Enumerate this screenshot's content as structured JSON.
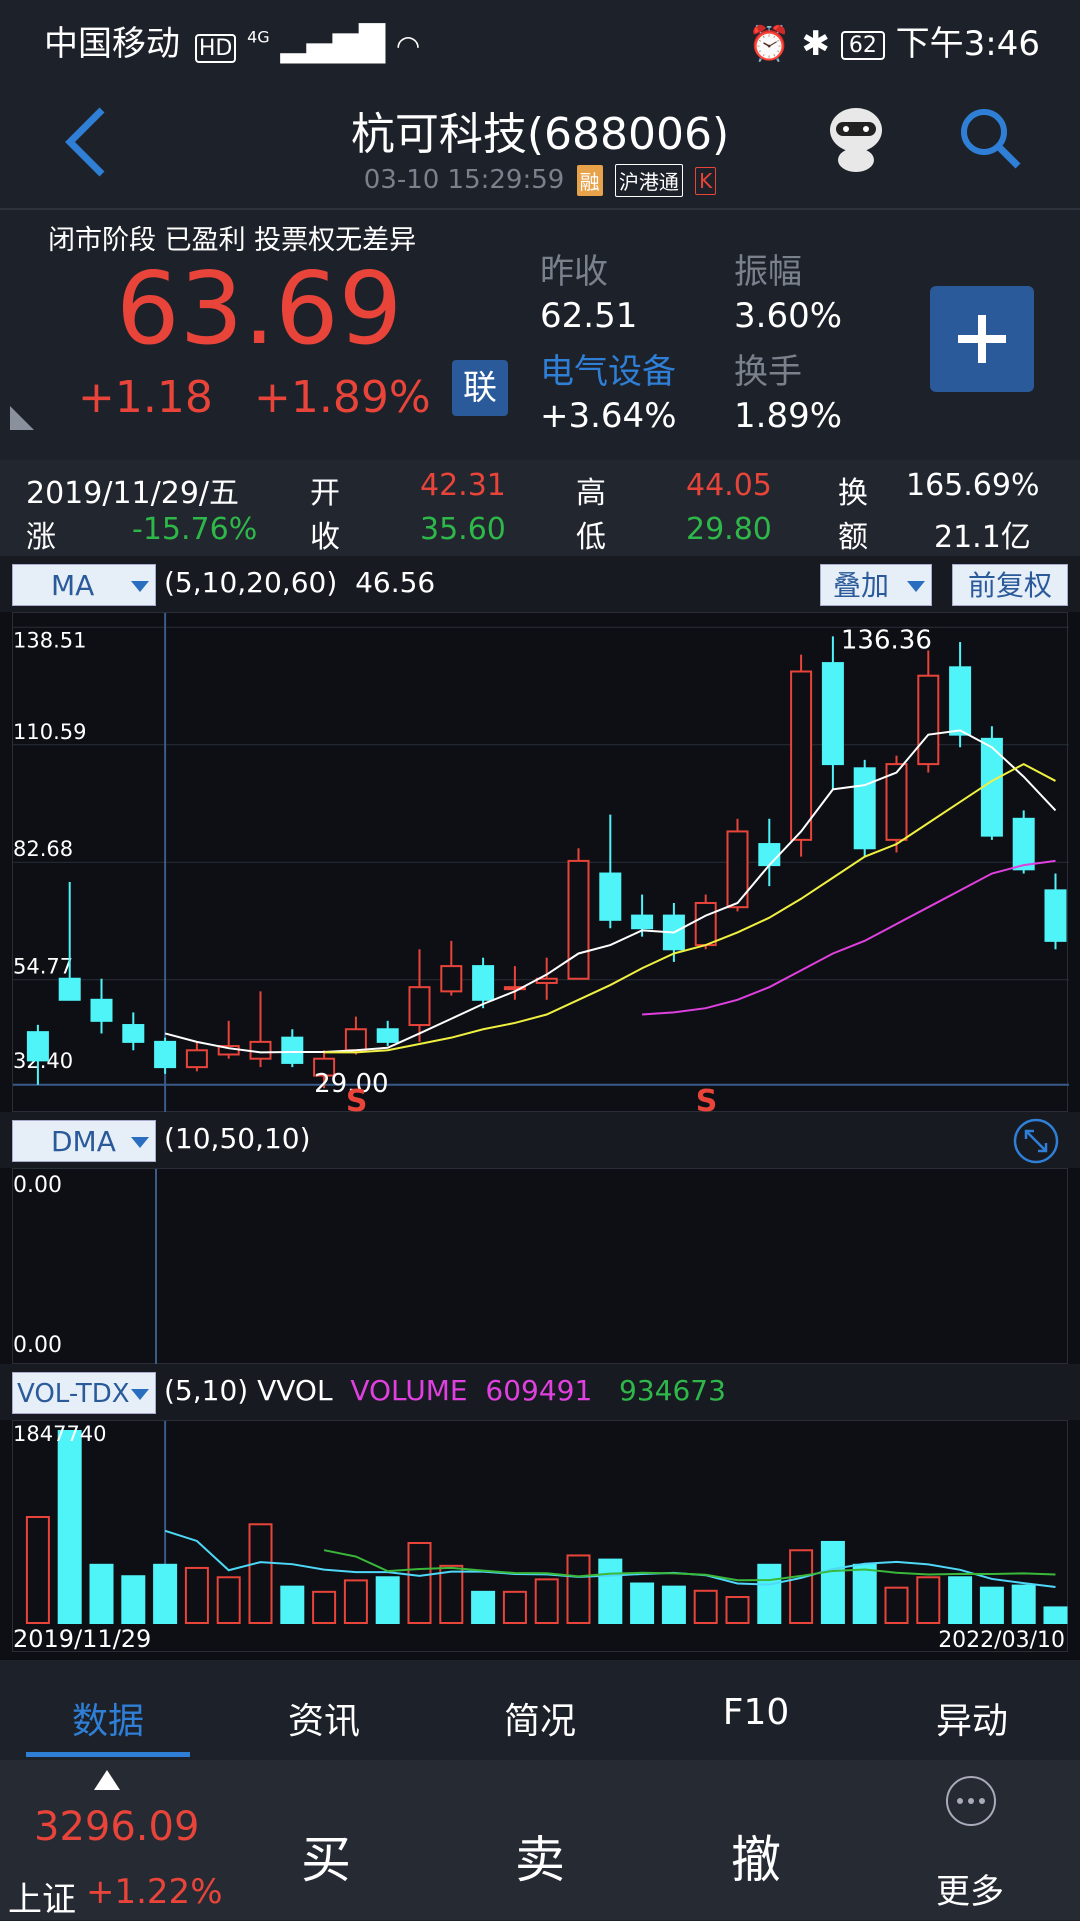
{
  "status": {
    "carrier": "中国移动",
    "hd": "HD",
    "net": "4G",
    "battery": "62",
    "time": "下午3:46"
  },
  "header": {
    "title": "杭可科技(688006)",
    "datetime": "03-10 15:29:59",
    "tag_rong": "融",
    "tag_hgt": "沪港通",
    "tag_k": "K"
  },
  "quote": {
    "phase": "闭市阶段  已盈利  投票权无差异",
    "price": "63.69",
    "change": "+1.18",
    "change_pct": "+1.89%",
    "lian": "联",
    "prev_close_label": "昨收",
    "prev_close": "62.51",
    "amplitude_label": "振幅",
    "amplitude": "3.60%",
    "sector": "电气设备",
    "sector_change": "+3.64%",
    "turnover_label": "换手",
    "turnover": "1.89%"
  },
  "detail": {
    "date": "2019/11/29/五",
    "open_label": "开",
    "open": "42.31",
    "high_label": "高",
    "high": "44.05",
    "turn_label": "换",
    "turn": "165.69%",
    "chg_label": "涨",
    "chg": "-15.76%",
    "close_label": "收",
    "close": "35.60",
    "low_label": "低",
    "low": "29.80",
    "amount_label": "额",
    "amount": "21.1亿"
  },
  "ma": {
    "name": "MA",
    "params": "(5,10,20,60)",
    "value": "46.56",
    "overlay": "叠加",
    "adjust": "前复权"
  },
  "price_axis": {
    "labels": [
      "138.51",
      "110.59",
      "82.68",
      "54.77",
      "32.40"
    ],
    "low_mark": "29.00",
    "high_mark": "136.36",
    "s_mark": "S"
  },
  "dma": {
    "name": "DMA",
    "params": "(10,50,10)",
    "top": "0.00",
    "bottom": "0.00"
  },
  "vol": {
    "name": "VOL-TDX",
    "params": "(5,10) VVOL",
    "volume_label": "VOLUME",
    "v1": "609491",
    "v2": "934673",
    "max": "1847740",
    "start_date": "2019/11/29",
    "end_date": "2022/03/10"
  },
  "tabs": [
    "数据",
    "资讯",
    "简况",
    "F10",
    "异动"
  ],
  "index": {
    "value": "3296.09",
    "name": "上证",
    "pct": "+1.22%"
  },
  "actions": {
    "buy": "买",
    "sell": "卖",
    "cancel": "撤",
    "more": "更多"
  },
  "chart_data": {
    "type": "candlestick",
    "candles": [
      {
        "o": 42.31,
        "c": 35.6,
        "h": 44.05,
        "l": 29.8
      },
      {
        "o": 55,
        "c": 50,
        "h": 78,
        "l": 52
      },
      {
        "o": 50,
        "c": 45,
        "h": 55,
        "l": 42
      },
      {
        "o": 44,
        "c": 40,
        "h": 47,
        "l": 38
      },
      {
        "o": 40,
        "c": 34,
        "h": 41,
        "l": 32.4
      },
      {
        "o": 34,
        "c": 38,
        "h": 40,
        "l": 33
      },
      {
        "o": 37,
        "c": 39,
        "h": 45,
        "l": 36
      },
      {
        "o": 36,
        "c": 40,
        "h": 52,
        "l": 34
      },
      {
        "o": 41,
        "c": 35,
        "h": 43,
        "l": 34
      },
      {
        "o": 32,
        "c": 36,
        "h": 38,
        "l": 29
      },
      {
        "o": 38,
        "c": 43,
        "h": 46,
        "l": 37
      },
      {
        "o": 43,
        "c": 40,
        "h": 45,
        "l": 39
      },
      {
        "o": 44,
        "c": 53,
        "h": 62,
        "l": 40
      },
      {
        "o": 52,
        "c": 58,
        "h": 64,
        "l": 51
      },
      {
        "o": 58,
        "c": 50,
        "h": 60,
        "l": 48
      },
      {
        "o": 53,
        "c": 53,
        "h": 58,
        "l": 50
      },
      {
        "o": 54,
        "c": 55,
        "h": 60,
        "l": 50
      },
      {
        "o": 55,
        "c": 83,
        "h": 86,
        "l": 55
      },
      {
        "o": 80,
        "c": 69,
        "h": 94,
        "l": 67
      },
      {
        "o": 70,
        "c": 67,
        "h": 75,
        "l": 65
      },
      {
        "o": 70,
        "c": 62,
        "h": 73,
        "l": 59
      },
      {
        "o": 63,
        "c": 73,
        "h": 75,
        "l": 62
      },
      {
        "o": 72,
        "c": 90,
        "h": 93,
        "l": 71
      },
      {
        "o": 87,
        "c": 82,
        "h": 93,
        "l": 77
      },
      {
        "o": 88,
        "c": 128,
        "h": 132,
        "l": 84
      },
      {
        "o": 130,
        "c": 106,
        "h": 136.36,
        "l": 100
      },
      {
        "o": 105,
        "c": 86,
        "h": 107,
        "l": 84
      },
      {
        "o": 88,
        "c": 106,
        "h": 108,
        "l": 85
      },
      {
        "o": 106,
        "c": 127,
        "h": 133,
        "l": 104
      },
      {
        "o": 129,
        "c": 113,
        "h": 135,
        "l": 110
      },
      {
        "o": 112,
        "c": 89,
        "h": 115,
        "l": 88
      },
      {
        "o": 93,
        "c": 81,
        "h": 95,
        "l": 80
      },
      {
        "o": 76,
        "c": 64,
        "h": 80,
        "l": 62
      }
    ],
    "ma5": [
      null,
      null,
      null,
      null,
      42,
      40,
      38.5,
      37.5,
      37.6,
      37.6,
      38,
      38.6,
      42,
      45.5,
      49,
      52,
      56,
      61,
      63,
      66.5,
      66,
      70,
      73,
      82,
      90,
      100,
      101,
      104,
      113,
      114,
      110,
      103,
      95
    ],
    "ma10": [
      null,
      null,
      null,
      null,
      null,
      null,
      null,
      null,
      null,
      37.5,
      37.5,
      38,
      39.5,
      41,
      43,
      44.5,
      46.5,
      50,
      53.5,
      57.5,
      61,
      63,
      66,
      69.5,
      74,
      79,
      84,
      87,
      92,
      97,
      102,
      106,
      102
    ],
    "ma20": [
      null,
      null,
      null,
      null,
      null,
      null,
      null,
      null,
      null,
      null,
      null,
      null,
      null,
      null,
      null,
      null,
      null,
      null,
      null,
      46.5,
      47,
      48,
      50,
      53,
      57,
      61,
      64,
      68,
      72,
      76,
      80,
      82,
      83
    ],
    "volume_series": [
      {
        "v": 1020000,
        "up": true
      },
      {
        "v": 1847740,
        "up": false
      },
      {
        "v": 560000,
        "up": false
      },
      {
        "v": 450000,
        "up": false
      },
      {
        "v": 560000,
        "up": false
      },
      {
        "v": 530000,
        "up": true
      },
      {
        "v": 440000,
        "up": true
      },
      {
        "v": 950000,
        "up": true
      },
      {
        "v": 350000,
        "up": false
      },
      {
        "v": 300000,
        "up": true
      },
      {
        "v": 410000,
        "up": true
      },
      {
        "v": 440000,
        "up": false
      },
      {
        "v": 770000,
        "up": true
      },
      {
        "v": 550000,
        "up": true
      },
      {
        "v": 300000,
        "up": false
      },
      {
        "v": 300000,
        "up": true
      },
      {
        "v": 420000,
        "up": true
      },
      {
        "v": 650000,
        "up": true
      },
      {
        "v": 610000,
        "up": false
      },
      {
        "v": 380000,
        "up": false
      },
      {
        "v": 350000,
        "up": false
      },
      {
        "v": 310000,
        "up": true
      },
      {
        "v": 250000,
        "up": true
      },
      {
        "v": 560000,
        "up": false
      },
      {
        "v": 700000,
        "up": true
      },
      {
        "v": 780000,
        "up": false
      },
      {
        "v": 560000,
        "up": false
      },
      {
        "v": 340000,
        "up": true
      },
      {
        "v": 440000,
        "up": true
      },
      {
        "v": 440000,
        "up": false
      },
      {
        "v": 340000,
        "up": false
      },
      {
        "v": 360000,
        "up": false
      },
      {
        "v": 150000,
        "up": false
      }
    ],
    "price_range": [
      25,
      140
    ],
    "volume_range": [
      0,
      1847740
    ]
  }
}
